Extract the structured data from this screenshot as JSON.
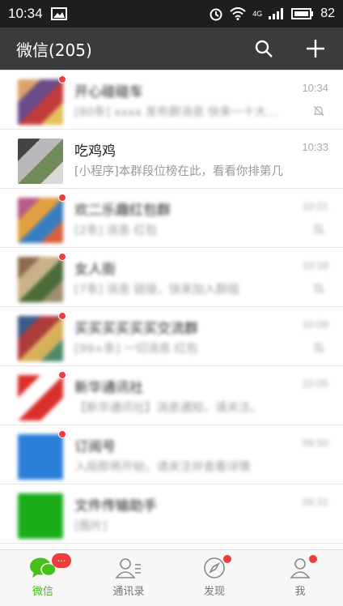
{
  "status_bar": {
    "time": "10:34",
    "battery": "82",
    "network": "4G"
  },
  "app_bar": {
    "title": "微信(205)"
  },
  "chats": [
    {
      "name": "开心碰碰车",
      "preview": "[80条] xxxx 发布群消息 快来一十大惊喜哦",
      "time": "10:34",
      "muted": true,
      "unread": true,
      "blur": true,
      "avatar_colors": [
        "#d9a36b",
        "#6b4b8a",
        "#c23b3b",
        "#e6c15a"
      ]
    },
    {
      "name": "吃鸡鸡",
      "preview": "[小程序]本群段位榜在此，看看你排第几",
      "time": "10:33",
      "muted": false,
      "unread": false,
      "blur": false,
      "avatar_colors": [
        "#444444",
        "#b8b8b8",
        "#6f8c5a",
        "#d9d9d9"
      ]
    },
    {
      "name": "欢二乐趣红包群",
      "preview": "[2条] 消息 红包",
      "time": "10:21",
      "muted": true,
      "unread": true,
      "blur": true,
      "avatar_colors": [
        "#b85a8a",
        "#e0a040",
        "#3a7dbf",
        "#d9603b"
      ]
    },
    {
      "name": "女人街",
      "preview": "[7条] 消息 链接，快来加入群组",
      "time": "10:18",
      "muted": true,
      "unread": true,
      "blur": true,
      "avatar_colors": [
        "#8c6b4b",
        "#c9b28a",
        "#4b6b3a",
        "#a09070"
      ]
    },
    {
      "name": "买买买买买买交流群",
      "preview": "[99+条] 一切消息 红包",
      "time": "10:09",
      "muted": true,
      "unread": true,
      "blur": true,
      "avatar_colors": [
        "#3b5a8a",
        "#b03b3b",
        "#d9b05a",
        "#4b8a6b"
      ]
    },
    {
      "name": "新华通讯社",
      "preview": "【新华通讯社】消息通知，请关注。",
      "time": "10:05",
      "muted": false,
      "unread": true,
      "blur": true,
      "avatar_colors": [
        "#d9302b",
        "#ffffff",
        "#d9302b",
        "#ffffff"
      ]
    },
    {
      "name": "订阅号",
      "preview": "入局即将开始，请关注并查看详情",
      "time": "09:50",
      "muted": false,
      "unread": true,
      "blur": true,
      "avatar_colors": [
        "#2b7fd9",
        "#2b7fd9",
        "#2b7fd9",
        "#2b7fd9"
      ]
    },
    {
      "name": "文件传输助手",
      "preview": "[图片]",
      "time": "09:31",
      "muted": false,
      "unread": false,
      "blur": true,
      "avatar_colors": [
        "#1aad19",
        "#1aad19",
        "#1aad19",
        "#1aad19"
      ]
    }
  ],
  "tabs": [
    {
      "label": "微信",
      "icon": "chat-bubble-icon",
      "active": true,
      "badge": "..."
    },
    {
      "label": "通讯录",
      "icon": "contacts-icon",
      "active": false,
      "badge": ""
    },
    {
      "label": "发现",
      "icon": "compass-icon",
      "active": false,
      "badge": "dot"
    },
    {
      "label": "我",
      "icon": "person-icon",
      "active": false,
      "badge": "dot"
    }
  ],
  "colors": {
    "accent": "#45c01a",
    "badge": "#f23b3b",
    "appbar": "#3a3b3d"
  }
}
